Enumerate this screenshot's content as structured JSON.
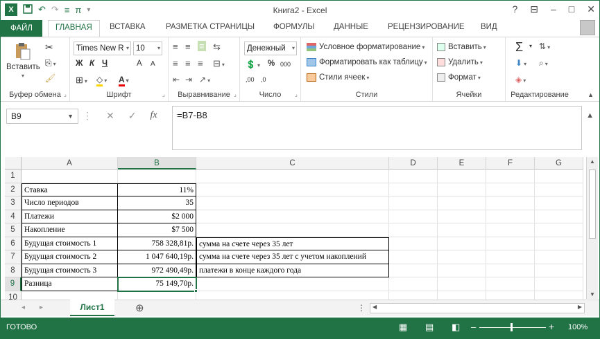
{
  "window": {
    "title": "Книга2 - Excel",
    "help": "?",
    "ribbon_opts": "⊟",
    "minimize": "–",
    "maximize": "□",
    "close": "✕"
  },
  "qat": {
    "logo": "X",
    "undo": "↶",
    "redo": "↷",
    "format": "≡",
    "pi": "π",
    "more": "▾"
  },
  "tabs": {
    "file": "ФАЙЛ",
    "home": "ГЛАВНАЯ",
    "insert": "ВСТАВКА",
    "layout": "РАЗМЕТКА СТРАНИЦЫ",
    "formulas": "ФОРМУЛЫ",
    "data": "ДАННЫЕ",
    "review": "РЕЦЕНЗИРОВАНИЕ",
    "view": "ВИД"
  },
  "ribbon": {
    "clipboard": {
      "label": "Буфер обмена",
      "paste": "Вставить"
    },
    "font": {
      "label": "Шрифт",
      "name": "Times New R",
      "size": "10",
      "bold": "Ж",
      "italic": "К",
      "underline": "Ч",
      "grow": "A",
      "shrink": "A"
    },
    "align": {
      "label": "Выравнивание"
    },
    "number": {
      "label": "Число",
      "format": "Денежный",
      "percent": "%",
      "thousands": "000",
      "inc": ",00",
      "dec": ",0"
    },
    "styles": {
      "label": "Стили",
      "conditional": "Условное форматирование",
      "table": "Форматировать как таблицу",
      "cellstyles": "Стили ячеек"
    },
    "cells": {
      "label": "Ячейки",
      "insert": "Вставить",
      "delete": "Удалить",
      "format": "Формат"
    },
    "editing": {
      "label": "Редактирование",
      "sum": "Σ"
    }
  },
  "formula_bar": {
    "name_box": "B9",
    "cancel": "✕",
    "enter": "✓",
    "fx": "fx",
    "formula": "=B7-B8"
  },
  "columns": [
    "A",
    "B",
    "C",
    "D",
    "E",
    "F",
    "G"
  ],
  "rows": [
    "1",
    "2",
    "3",
    "4",
    "5",
    "6",
    "7",
    "8",
    "9",
    "10"
  ],
  "cells": {
    "r2": {
      "a": "Ставка",
      "b": "11%",
      "c": ""
    },
    "r3": {
      "a": "Число периодов",
      "b": "35",
      "c": ""
    },
    "r4": {
      "a": "Платежи",
      "b": "$2 000",
      "c": ""
    },
    "r5": {
      "a": "Накопление",
      "b": "$7 500",
      "c": ""
    },
    "r6": {
      "a": "Будущая стоимость 1",
      "b": "758 328,81р.",
      "c": "сумма на счете через 35 лет"
    },
    "r7": {
      "a": "Будущая стоимость 2",
      "b": "1 047 640,19р.",
      "c": "сумма на счете через 35 лет с учетом накоплений"
    },
    "r8": {
      "a": "Будущая стоимость 3",
      "b": "972 490,49р.",
      "c": "платежи в конце каждого года"
    },
    "r9": {
      "a": "Разница",
      "b": "75 149,70р.",
      "c": ""
    }
  },
  "sheets": {
    "active": "Лист1",
    "add": "⊕",
    "prev": "◂",
    "next": "▸"
  },
  "status": {
    "ready": "ГОТОВО",
    "zoom": "100%",
    "minus": "–",
    "plus": "+"
  }
}
